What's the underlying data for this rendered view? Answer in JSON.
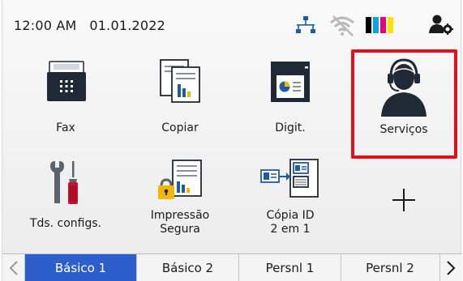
{
  "status": {
    "time": "12:00 AM",
    "date": "01.01.2022",
    "icons": [
      "wired-network-icon",
      "wifi-off-icon",
      "toner-levels-icon",
      "user-settings-icon"
    ],
    "toner_colors": [
      "#000000",
      "#00a6e8",
      "#e6007e",
      "#ffe100"
    ]
  },
  "tiles": [
    {
      "id": "fax",
      "label_lines": [
        "Fax"
      ]
    },
    {
      "id": "copy",
      "label_lines": [
        "Copiar"
      ]
    },
    {
      "id": "scan",
      "label_lines": [
        "Digit."
      ]
    },
    {
      "id": "services",
      "label_lines": [
        "Serviços"
      ],
      "highlighted": true
    },
    {
      "id": "settings",
      "label_lines": [
        "Tds. configs."
      ]
    },
    {
      "id": "secure-print",
      "label_lines": [
        "Impressão",
        "Segura"
      ]
    },
    {
      "id": "id-copy",
      "label_lines": [
        "Cópia ID",
        "2 em 1"
      ]
    },
    {
      "id": "add",
      "label_lines": [
        ""
      ],
      "icon": "plus-icon"
    }
  ],
  "tabs": [
    {
      "label": "Básico 1",
      "active": true
    },
    {
      "label": "Básico 2",
      "active": false
    },
    {
      "label": "Persnl 1",
      "active": false
    },
    {
      "label": "Persnl 2",
      "active": false
    }
  ],
  "colors": {
    "accent_tab": "#2e5ecb",
    "highlight": "#e3101c",
    "icon_dark": "#1f2a36",
    "icon_blue": "#1d5ba8",
    "icon_yellow": "#f2b800",
    "icon_red": "#c8102e"
  }
}
